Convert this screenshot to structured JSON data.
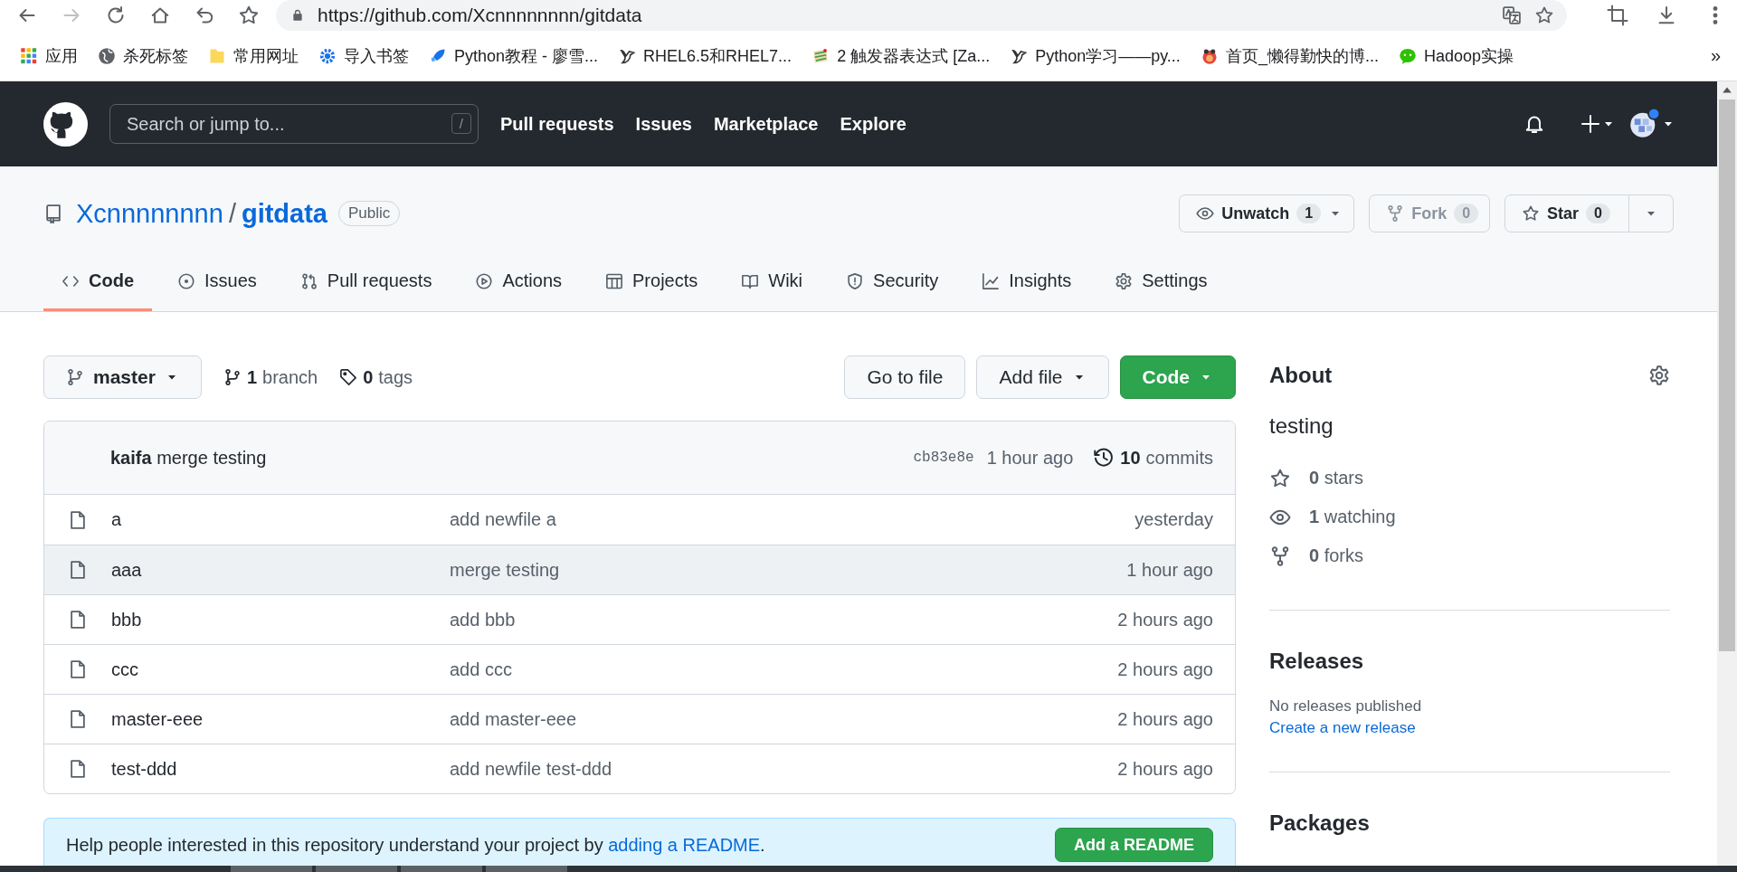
{
  "browser": {
    "toolbar_buttons": [
      {
        "kind": "back",
        "disabled": false
      },
      {
        "kind": "forward",
        "disabled": true
      },
      {
        "kind": "reload",
        "disabled": false
      },
      {
        "kind": "home",
        "disabled": false
      },
      {
        "kind": "undo",
        "disabled": false
      },
      {
        "kind": "star",
        "disabled": false
      }
    ],
    "url": "https://github.com/Xcnnnnnnnn/gitdata",
    "bookmarks": [
      {
        "kind": "apps",
        "label": "应用"
      },
      {
        "kind": "globe",
        "label": "杀死标签"
      },
      {
        "kind": "folder",
        "label": "常用网址"
      },
      {
        "kind": "gear",
        "label": "导入书签"
      },
      {
        "kind": "rocket",
        "label": "Python教程 - 廖雪..."
      },
      {
        "kind": "bird",
        "label": "RHEL6.5和RHEL7..."
      },
      {
        "kind": "palette",
        "label": "2 触发器表达式 [Za..."
      },
      {
        "kind": "bird",
        "label": "Python学习——py..."
      },
      {
        "kind": "bug",
        "label": "首页_懒得勤快的博..."
      },
      {
        "kind": "chat",
        "label": "Hadoop实操"
      }
    ],
    "more": "»"
  },
  "header": {
    "search": {
      "placeholder": "Search or jump to...",
      "key": "/"
    },
    "nav": [
      "Pull requests",
      "Issues",
      "Marketplace",
      "Explore"
    ]
  },
  "repo": {
    "owner": "Xcnnnnnnnn",
    "separator": "/",
    "name": "gitdata",
    "visibility": "Public",
    "actions": [
      {
        "kind": "watch",
        "label": "Unwatch",
        "count": "1",
        "disabled": false
      },
      {
        "kind": "fork",
        "label": "Fork",
        "count": "0",
        "disabled": true
      },
      {
        "kind": "star",
        "label": "Star",
        "count": "0",
        "disabled": false
      }
    ],
    "tabs": [
      {
        "kind": "code",
        "label": "Code",
        "selected": true
      },
      {
        "kind": "issue",
        "label": "Issues",
        "selected": false
      },
      {
        "kind": "pr",
        "label": "Pull requests",
        "selected": false
      },
      {
        "kind": "play",
        "label": "Actions",
        "selected": false
      },
      {
        "kind": "table",
        "label": "Projects",
        "selected": false
      },
      {
        "kind": "book",
        "label": "Wiki",
        "selected": false
      },
      {
        "kind": "shield",
        "label": "Security",
        "selected": false
      },
      {
        "kind": "graph",
        "label": "Insights",
        "selected": false
      },
      {
        "kind": "gear",
        "label": "Settings",
        "selected": false
      }
    ]
  },
  "branch_bar": {
    "branch": "master",
    "branch_count": "1",
    "branch_label": "branch",
    "tag_count": "0",
    "tag_label": "tags",
    "buttons": [
      "Go to file",
      "Add file",
      "Code"
    ]
  },
  "commit": {
    "author": "kaifa",
    "message": "merge testing",
    "sha": "cb83e8e",
    "time": "1 hour ago",
    "count": "10",
    "count_label": "commits"
  },
  "files": [
    {
      "name": "a",
      "message": "add newfile a",
      "time": "yesterday",
      "hovered": false
    },
    {
      "name": "aaa",
      "message": "merge testing",
      "time": "1 hour ago",
      "hovered": true
    },
    {
      "name": "bbb",
      "message": "add bbb",
      "time": "2 hours ago",
      "hovered": false
    },
    {
      "name": "ccc",
      "message": "add ccc",
      "time": "2 hours ago",
      "hovered": false
    },
    {
      "name": "master-eee",
      "message": "add master-eee",
      "time": "2 hours ago",
      "hovered": false
    },
    {
      "name": "test-ddd",
      "message": "add newfile test-ddd",
      "time": "2 hours ago",
      "hovered": false
    }
  ],
  "readme_banner": {
    "text": "Help people interested in this repository understand your project by",
    "link": "adding a README",
    "end": ".",
    "button": "Add a README"
  },
  "sidebar": {
    "about": "About",
    "description": "testing",
    "stats": [
      {
        "kind": "star",
        "count": "0",
        "label": "stars"
      },
      {
        "kind": "eye",
        "count": "1",
        "label": "watching"
      },
      {
        "kind": "fork",
        "count": "0",
        "label": "forks"
      }
    ],
    "releases": {
      "title": "Releases",
      "note": "No releases published",
      "link": "Create a new release"
    },
    "packages": {
      "title": "Packages"
    }
  }
}
